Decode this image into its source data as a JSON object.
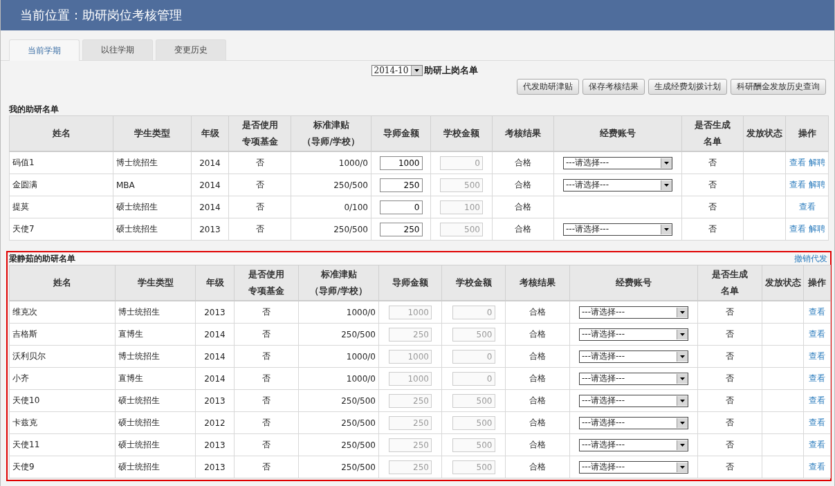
{
  "header": {
    "title": "当前位置：助研岗位考核管理"
  },
  "tabs": [
    {
      "label": "当前学期",
      "selected": true
    },
    {
      "label": "以往学期",
      "selected": false
    },
    {
      "label": "变更历史",
      "selected": false
    }
  ],
  "period": {
    "value": "2014-10",
    "label": "助研上岗名单"
  },
  "buttons": [
    "代发助研津贴",
    "保存考核结果",
    "生成经费划拨计划",
    "科研酬金发放历史查询"
  ],
  "sections": [
    {
      "title": "我的助研名单",
      "highlighted": false,
      "columns": [
        [
          "姓名"
        ],
        [
          "学生类型"
        ],
        [
          "年级"
        ],
        [
          "是否使用",
          "专项基金"
        ],
        [
          "标准津贴",
          "（导师/学校）"
        ],
        [
          "导师金额"
        ],
        [
          "学校金额"
        ],
        [
          "考核结果"
        ],
        [
          "经费账号"
        ],
        [
          "是否生成",
          "名单"
        ],
        [
          "发放状态"
        ],
        [
          "操作"
        ]
      ],
      "rows": [
        {
          "name": "码值1",
          "type": "博士统招生",
          "grade": "2014",
          "special_fund": "否",
          "standard": "1000/0",
          "tutor_amount": {
            "value": "1000",
            "disabled": false
          },
          "school_amount": {
            "value": "0",
            "disabled": true
          },
          "result": "合格",
          "account": "---请选择---",
          "generated": "否",
          "actions": [
            "查看",
            "解聘"
          ]
        },
        {
          "name": "金圆满",
          "type": "MBA",
          "grade": "2014",
          "special_fund": "否",
          "standard": "250/500",
          "tutor_amount": {
            "value": "250",
            "disabled": false
          },
          "school_amount": {
            "value": "500",
            "disabled": true
          },
          "result": "合格",
          "account": "---请选择---",
          "generated": "否",
          "actions": [
            "查看",
            "解聘"
          ]
        },
        {
          "name": "提莫",
          "type": "硕士统招生",
          "grade": "2014",
          "special_fund": "否",
          "standard": "0/100",
          "tutor_amount": {
            "value": "0",
            "disabled": false
          },
          "school_amount": {
            "value": "100",
            "disabled": true
          },
          "result": "合格",
          "generated": "否",
          "actions": [
            "查看"
          ]
        },
        {
          "name": "天使7",
          "type": "硕士统招生",
          "grade": "2013",
          "special_fund": "否",
          "standard": "250/500",
          "tutor_amount": {
            "value": "250",
            "disabled": false
          },
          "school_amount": {
            "value": "500",
            "disabled": true
          },
          "result": "合格",
          "account": "---请选择---",
          "generated": "否",
          "actions": [
            "查看",
            "解聘"
          ]
        }
      ]
    },
    {
      "title": "梁静茹的助研名单",
      "highlighted": true,
      "link": "撤销代发",
      "columns": [
        [
          "姓名"
        ],
        [
          "学生类型"
        ],
        [
          "年级"
        ],
        [
          "是否使用",
          "专项基金"
        ],
        [
          "标准津贴",
          "（导师/学校）"
        ],
        [
          "导师金额"
        ],
        [
          "学校金额"
        ],
        [
          "考核结果"
        ],
        [
          "经费账号"
        ],
        [
          "是否生成",
          "名单"
        ],
        [
          "发放状态"
        ],
        [
          "操作"
        ]
      ],
      "rows": [
        {
          "name": "维克次",
          "type": "博士统招生",
          "grade": "2013",
          "special_fund": "否",
          "standard": "1000/0",
          "tutor_amount": {
            "value": "1000",
            "disabled": true
          },
          "school_amount": {
            "value": "0",
            "disabled": true
          },
          "result": "合格",
          "account": "---请选择---",
          "generated": "否",
          "actions": [
            "查看"
          ]
        },
        {
          "name": "吉格斯",
          "type": "直博生",
          "grade": "2014",
          "special_fund": "否",
          "standard": "250/500",
          "tutor_amount": {
            "value": "250",
            "disabled": true
          },
          "school_amount": {
            "value": "500",
            "disabled": true
          },
          "result": "合格",
          "account": "---请选择---",
          "generated": "否",
          "actions": [
            "查看"
          ]
        },
        {
          "name": "沃利贝尔",
          "type": "博士统招生",
          "grade": "2014",
          "special_fund": "否",
          "standard": "1000/0",
          "tutor_amount": {
            "value": "1000",
            "disabled": true
          },
          "school_amount": {
            "value": "0",
            "disabled": true
          },
          "result": "合格",
          "account": "---请选择---",
          "generated": "否",
          "actions": [
            "查看"
          ]
        },
        {
          "name": "小齐",
          "type": "直博生",
          "grade": "2014",
          "special_fund": "否",
          "standard": "1000/0",
          "tutor_amount": {
            "value": "1000",
            "disabled": true
          },
          "school_amount": {
            "value": "0",
            "disabled": true
          },
          "result": "合格",
          "account": "---请选择---",
          "generated": "否",
          "actions": [
            "查看"
          ]
        },
        {
          "name": "天使10",
          "type": "硕士统招生",
          "grade": "2013",
          "special_fund": "否",
          "standard": "250/500",
          "tutor_amount": {
            "value": "250",
            "disabled": true
          },
          "school_amount": {
            "value": "500",
            "disabled": true
          },
          "result": "合格",
          "account": "---请选择---",
          "generated": "否",
          "actions": [
            "查看"
          ]
        },
        {
          "name": "卡兹克",
          "type": "硕士统招生",
          "grade": "2012",
          "special_fund": "否",
          "standard": "250/500",
          "tutor_amount": {
            "value": "250",
            "disabled": true
          },
          "school_amount": {
            "value": "500",
            "disabled": true
          },
          "result": "合格",
          "account": "---请选择---",
          "generated": "否",
          "actions": [
            "查看"
          ]
        },
        {
          "name": "天使11",
          "type": "硕士统招生",
          "grade": "2013",
          "special_fund": "否",
          "standard": "250/500",
          "tutor_amount": {
            "value": "250",
            "disabled": true
          },
          "school_amount": {
            "value": "500",
            "disabled": true
          },
          "result": "合格",
          "account": "---请选择---",
          "generated": "否",
          "actions": [
            "查看"
          ]
        },
        {
          "name": "天使9",
          "type": "硕士统招生",
          "grade": "2013",
          "special_fund": "否",
          "standard": "250/500",
          "tutor_amount": {
            "value": "250",
            "disabled": true
          },
          "school_amount": {
            "value": "500",
            "disabled": true
          },
          "result": "合格",
          "account": "---请选择---",
          "generated": "否",
          "actions": [
            "查看"
          ]
        }
      ]
    }
  ]
}
